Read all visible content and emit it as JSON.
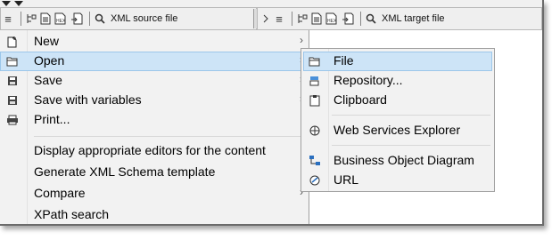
{
  "toolbar_left": {
    "search_label": "XML source file"
  },
  "toolbar_right": {
    "search_label": "XML target file"
  },
  "toolbar_icons": [
    "menu-icon",
    "tree-icon",
    "document-icon",
    "hex-icon",
    "import-icon",
    "search-icon"
  ],
  "context_menu": {
    "items": [
      {
        "label": "New",
        "icon": "new-document-icon",
        "submenu": true
      },
      {
        "label": "Open",
        "icon": "folder-icon",
        "submenu": true,
        "highlighted": true
      },
      {
        "label": "Save",
        "icon": "save-icon",
        "submenu": true
      },
      {
        "label": "Save with variables",
        "icon": "save-variables-icon",
        "submenu": true
      },
      {
        "label": "Print...",
        "icon": "print-icon",
        "submenu": false
      },
      {
        "label": "Display appropriate editors for the content",
        "icon": "",
        "submenu": false
      },
      {
        "label": "Generate XML Schema template",
        "icon": "",
        "submenu": false
      },
      {
        "label": "Compare",
        "icon": "",
        "submenu": true
      },
      {
        "label": "XPath search",
        "icon": "",
        "submenu": false
      }
    ]
  },
  "open_submenu": {
    "items": [
      {
        "label": "File",
        "icon": "folder-icon",
        "highlighted": true
      },
      {
        "label": "Repository...",
        "icon": "repository-icon"
      },
      {
        "label": "Clipboard",
        "icon": "clipboard-icon"
      },
      {
        "label": "Web Services Explorer",
        "icon": "web-services-icon"
      },
      {
        "label": "Business Object Diagram",
        "icon": "diagram-icon"
      },
      {
        "label": "URL",
        "icon": "url-icon"
      }
    ]
  },
  "colors": {
    "highlight": "#cde4f7",
    "highlight_border": "#9cc7ea",
    "menu_bg": "#f2f2f2",
    "toolbar_bg": "#efefef"
  }
}
